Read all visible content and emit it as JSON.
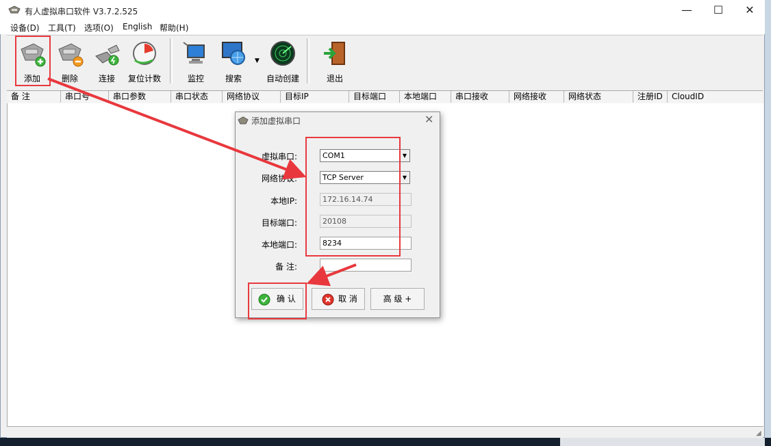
{
  "window": {
    "title": "有人虚拟串口软件 V3.7.2.525",
    "controls": {
      "minimize": "—",
      "maximize": "☐",
      "close": "✕"
    }
  },
  "menu": [
    "设备(D)",
    "工具(T)",
    "选项(O)",
    "English",
    "帮助(H)"
  ],
  "toolbar": {
    "add": "添加",
    "delete": "删除",
    "connect": "连接",
    "reset_count": "复位计数",
    "monitor": "监控",
    "search": "搜索",
    "auto_create": "自动创建",
    "exit": "退出"
  },
  "columns": [
    "备 注",
    "串口号",
    "串口参数",
    "串口状态",
    "网络协议",
    "目标IP",
    "目标端口",
    "本地端口",
    "串口接收",
    "网络接收",
    "网络状态",
    "注册ID",
    "CloudID"
  ],
  "dialog": {
    "title": "添加虚拟串口",
    "close": "✕",
    "labels": {
      "virtual_port": "虚拟串口:",
      "protocol": "网络协议:",
      "local_ip": "本地IP:",
      "target_port": "目标端口:",
      "local_port": "本地端口:",
      "remark": "备  注:"
    },
    "values": {
      "virtual_port": "COM1",
      "protocol": "TCP Server",
      "local_ip": "172.16.14.74",
      "target_port": "20108",
      "local_port": "8234",
      "remark": ""
    },
    "buttons": {
      "ok": "确 认",
      "cancel": "取 消",
      "advanced": "高 级 +"
    }
  },
  "colors": {
    "annotation_red": "#e8383d"
  }
}
